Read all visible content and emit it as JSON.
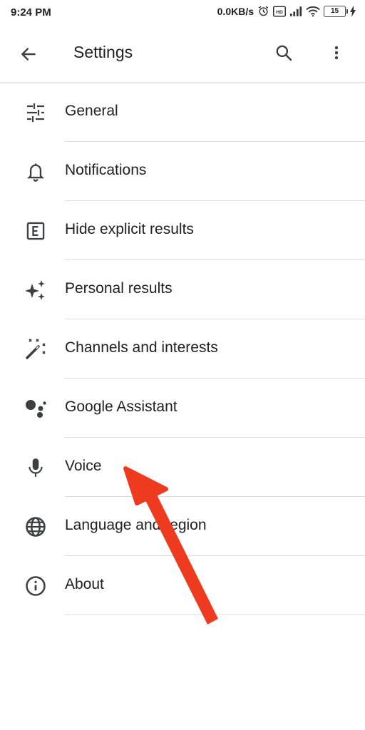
{
  "status_bar": {
    "time": "9:24 PM",
    "network_speed": "0.0KB/s",
    "battery_level": "15"
  },
  "app_bar": {
    "title": "Settings",
    "icons": [
      "back-arrow-icon",
      "search-icon",
      "more-vert-icon"
    ]
  },
  "settings": {
    "items": [
      {
        "label": "General",
        "icon": "tune-icon"
      },
      {
        "label": "Notifications",
        "icon": "bell-icon"
      },
      {
        "label": "Hide explicit results",
        "icon": "explicit-icon"
      },
      {
        "label": "Personal results",
        "icon": "sparkle-icon"
      },
      {
        "label": "Channels and interests",
        "icon": "magic-wand-icon"
      },
      {
        "label": "Google Assistant",
        "icon": "assistant-icon"
      },
      {
        "label": "Voice",
        "icon": "mic-icon"
      },
      {
        "label": "Language and region",
        "icon": "globe-icon"
      },
      {
        "label": "About",
        "icon": "info-icon"
      }
    ]
  },
  "annotation": {
    "arrow_color": "#ee3b1f",
    "points_to": "Voice"
  }
}
